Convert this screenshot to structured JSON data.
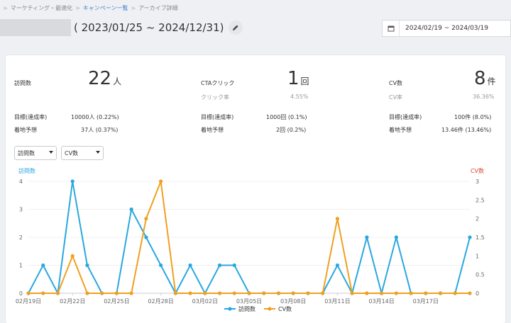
{
  "breadcrumb": {
    "items": [
      {
        "label": "マーケティング・最適化",
        "link": false
      },
      {
        "label": "キャンペーン一覧",
        "link": true
      },
      {
        "label": "アーカイブ詳細",
        "link": false
      }
    ],
    "separator": ">"
  },
  "header": {
    "period": "( 2023/01/25 ~ 2024/12/31)",
    "edit_icon": "pencil-icon"
  },
  "date_filter": {
    "icon": "calendar-icon",
    "range": "2024/02/19 ~ 2024/03/19"
  },
  "metrics": [
    {
      "label": "訪問数",
      "value": "22",
      "unit": "人",
      "sub_label": "",
      "sub_value": "",
      "goal_label": "目標(達成率)",
      "goal_value": "10000人 (0.22%)",
      "forecast_label": "着地予想",
      "forecast_value": "37人 (0.37%)"
    },
    {
      "label": "CTAクリック",
      "value": "1",
      "unit": "回",
      "sub_label": "クリック率",
      "sub_value": "4.55%",
      "goal_label": "目標(達成率)",
      "goal_value": "1000回 (0.1%)",
      "forecast_label": "着地予想",
      "forecast_value": "2回 (0.2%)"
    },
    {
      "label": "CV数",
      "value": "8",
      "unit": "件",
      "sub_label": "CV率",
      "sub_value": "36.36%",
      "goal_label": "目標(達成率)",
      "goal_value": "100件 (8.0%)",
      "forecast_label": "着地予想",
      "forecast_value": "13.46件 (13.46%)"
    }
  ],
  "selectors": {
    "left": "訪問数",
    "right": "CV数"
  },
  "colors": {
    "visits": "#29a8e0",
    "cv": "#f0a020",
    "cv_light": "#f8d6a8",
    "axis_left_label": "#29a8e0",
    "axis_right_label": "#e0442f"
  },
  "chart_data": {
    "type": "line",
    "ylabel_left": "訪問数",
    "ylabel_right": "CV数",
    "ylim_left": [
      0,
      4
    ],
    "ylim_right": [
      0,
      3
    ],
    "left_ticks": [
      "0",
      "1",
      "2",
      "3",
      "4"
    ],
    "right_ticks": [
      "0",
      "0.5",
      "1",
      "1.5",
      "2",
      "2.5",
      "3"
    ],
    "x": [
      "02月19日",
      "02月20日",
      "02月21日",
      "02月22日",
      "02月23日",
      "02月24日",
      "02月25日",
      "02月26日",
      "02月27日",
      "02月28日",
      "02月29日",
      "03月01日",
      "03月02日",
      "03月03日",
      "03月04日",
      "03月05日",
      "03月06日",
      "03月07日",
      "03月08日",
      "03月09日",
      "03月10日",
      "03月11日",
      "03月12日",
      "03月13日",
      "03月14日",
      "03月15日",
      "03月16日",
      "03月17日",
      "03月18日",
      "03月19日",
      "03月20日"
    ],
    "x_tick_labels": [
      "02月19日",
      "02月22日",
      "02月25日",
      "02月28日",
      "03月02日",
      "03月05日",
      "03月08日",
      "03月11日",
      "03月14日",
      "03月17日"
    ],
    "x_tick_index": [
      0,
      3,
      6,
      9,
      12,
      15,
      18,
      21,
      24,
      27
    ],
    "series": [
      {
        "name": "訪問数",
        "axis": "left",
        "values": [
          0,
          1,
          0,
          4,
          1,
          0,
          0,
          3,
          2,
          1,
          0,
          1,
          0,
          1,
          1,
          0,
          0,
          0,
          0,
          0,
          0,
          1,
          0,
          2,
          0,
          2,
          0,
          0,
          0,
          0,
          2
        ]
      },
      {
        "name": "CV数",
        "axis": "right",
        "values": [
          0,
          0,
          0,
          1,
          0,
          0,
          0,
          0,
          2,
          3,
          0,
          0,
          0,
          0,
          0,
          0,
          0,
          0,
          0,
          0,
          0,
          2,
          0,
          0,
          0,
          0,
          0,
          0,
          0,
          0,
          0
        ]
      }
    ],
    "legend_position": "bottom-center",
    "grid": true
  }
}
